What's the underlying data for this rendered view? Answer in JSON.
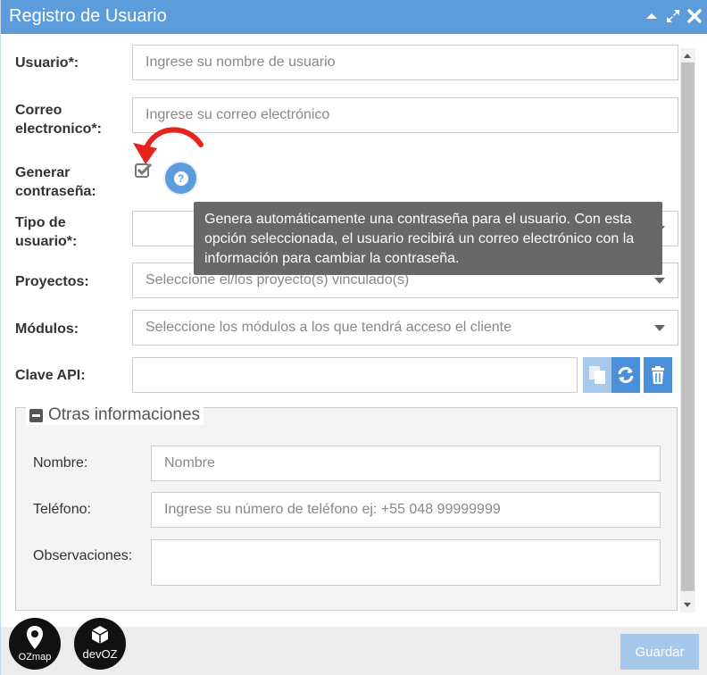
{
  "window": {
    "title": "Registro de Usuario"
  },
  "fields": {
    "usuario_label": "Usuario*:",
    "usuario_placeholder": "Ingrese su nombre de usuario",
    "correo_label_1": "Correo",
    "correo_label_2": "electronico*:",
    "correo_placeholder": "Ingrese su correo electrónico",
    "generar_label_1": "Generar",
    "generar_label_2": "contraseña:",
    "generar_checked": true,
    "help_icon": "?",
    "tipo_label_1": "Tipo de",
    "tipo_label_2": "usuario*:",
    "proyectos_label": "Proyectos:",
    "proyectos_placeholder": "Seleccione el/los proyecto(s) vinculado(s)",
    "modulos_label": "Módulos:",
    "modulos_placeholder": "Seleccione los módulos a los que tendrá acceso el cliente",
    "clave_label": "Clave API:"
  },
  "tooltip": {
    "line1": "Genera automáticamente una contraseña para el usuario. Con esta",
    "line2": "opción seleccionada, el usuario recibirá un correo electrónico con la",
    "line3": "información para cambiar la contraseña."
  },
  "other_info": {
    "legend": "Otras informaciones",
    "nombre_label": "Nombre:",
    "nombre_placeholder": "Nombre",
    "telefono_label": "Teléfono:",
    "telefono_placeholder": "Ingrese su número de teléfono ej: +55 048 99999999",
    "observaciones_label": "Observaciones:"
  },
  "footer": {
    "logo1_text": "OZmap",
    "logo2_text": "devOZ",
    "save_label": "Guardar"
  },
  "colors": {
    "titlebar": "#5d9cdb",
    "arrow": "#e8231e",
    "tooltip": "#686868",
    "save_button": "#a6c8ea"
  },
  "icons": [
    "chevron-up-icon",
    "expand-icon",
    "close-icon",
    "checkbox-checked-icon",
    "help-icon",
    "copy-icon",
    "refresh-icon",
    "trash-icon",
    "minus-square-icon",
    "red-curved-arrow-icon",
    "ozmap-pin-logo",
    "devoz-cube-logo"
  ]
}
